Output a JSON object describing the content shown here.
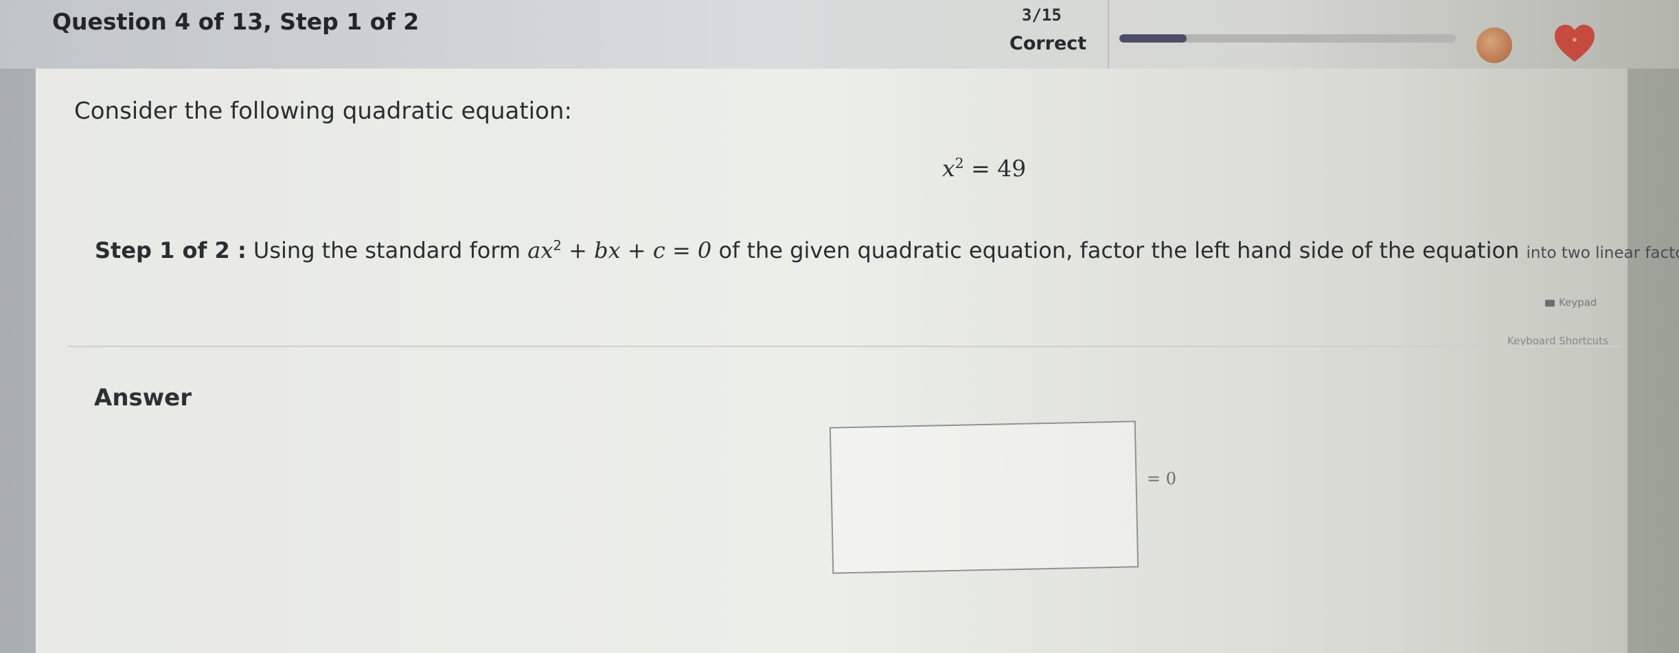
{
  "header": {
    "question_title": "Question 4 of 13, Step 1 of 2",
    "score": "3/15",
    "status": "Correct",
    "progress_fraction": 0.2,
    "coin_color": "#b7774f",
    "heart_color": "#c64a3e"
  },
  "problem": {
    "intro": "Consider the following quadratic equation:",
    "equation_base": "x",
    "equation_exponent": "2",
    "equation_rest": " = 49",
    "step_label": "Step 1 of 2 :",
    "step_text_before": " Using the standard form ",
    "std_a": "ax",
    "std_exp": "2",
    "std_rest": " + bx + c = 0",
    "step_text_after": " of the given quadratic equation, factor the left hand side of the equation ",
    "step_text_tail": "into two linear factors."
  },
  "tools": {
    "keypad_label": "Keypad",
    "shortcuts_label": "Keyboard Shortcuts"
  },
  "answer": {
    "label": "Answer",
    "input_value": "",
    "equals_zero": "= 0"
  }
}
